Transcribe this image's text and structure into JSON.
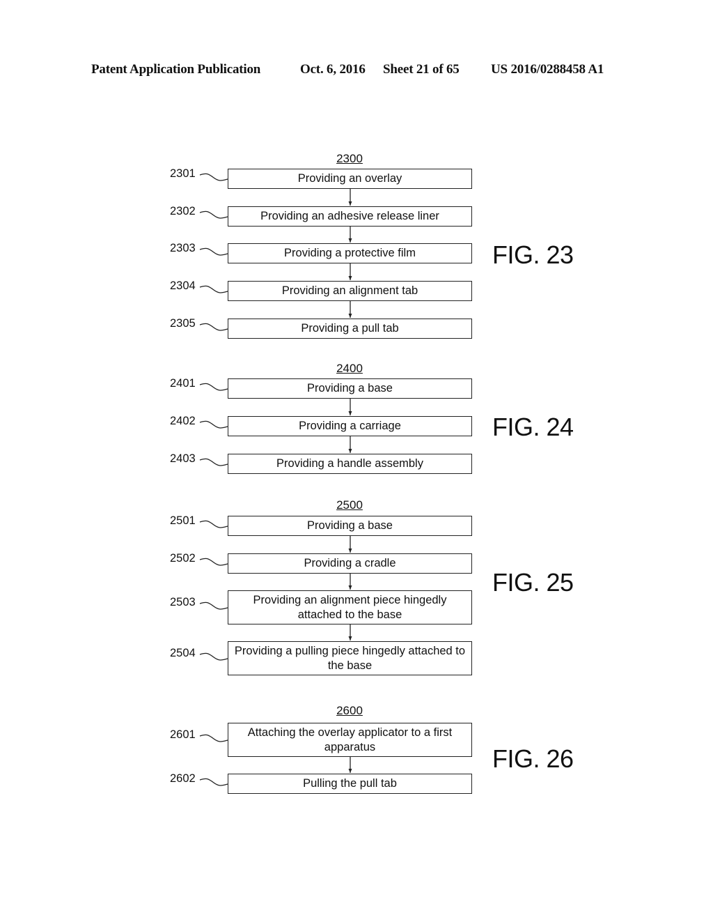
{
  "header": {
    "publication": "Patent Application Publication",
    "date": "Oct. 6, 2016",
    "sheet": "Sheet 21 of 65",
    "number": "US 2016/0288458 A1"
  },
  "figures": [
    {
      "label": "FIG. 23",
      "number": "2300",
      "steps": [
        {
          "ref": "2301",
          "text": "Providing an overlay"
        },
        {
          "ref": "2302",
          "text": "Providing an adhesive release liner"
        },
        {
          "ref": "2303",
          "text": "Providing a protective film"
        },
        {
          "ref": "2304",
          "text": "Providing an alignment tab"
        },
        {
          "ref": "2305",
          "text": "Providing a pull tab"
        }
      ]
    },
    {
      "label": "FIG. 24",
      "number": "2400",
      "steps": [
        {
          "ref": "2401",
          "text": "Providing a base"
        },
        {
          "ref": "2402",
          "text": "Providing a carriage"
        },
        {
          "ref": "2403",
          "text": "Providing a handle assembly"
        }
      ]
    },
    {
      "label": "FIG. 25",
      "number": "2500",
      "steps": [
        {
          "ref": "2501",
          "text": "Providing a base"
        },
        {
          "ref": "2502",
          "text": "Providing a cradle"
        },
        {
          "ref": "2503",
          "text": "Providing an alignment piece hingedly attached to the base"
        },
        {
          "ref": "2504",
          "text": "Providing a pulling piece hingedly attached to the base"
        }
      ]
    },
    {
      "label": "FIG. 26",
      "number": "2600",
      "steps": [
        {
          "ref": "2601",
          "text": "Attaching the overlay applicator to a first apparatus"
        },
        {
          "ref": "2602",
          "text": "Pulling the pull tab"
        }
      ]
    }
  ]
}
